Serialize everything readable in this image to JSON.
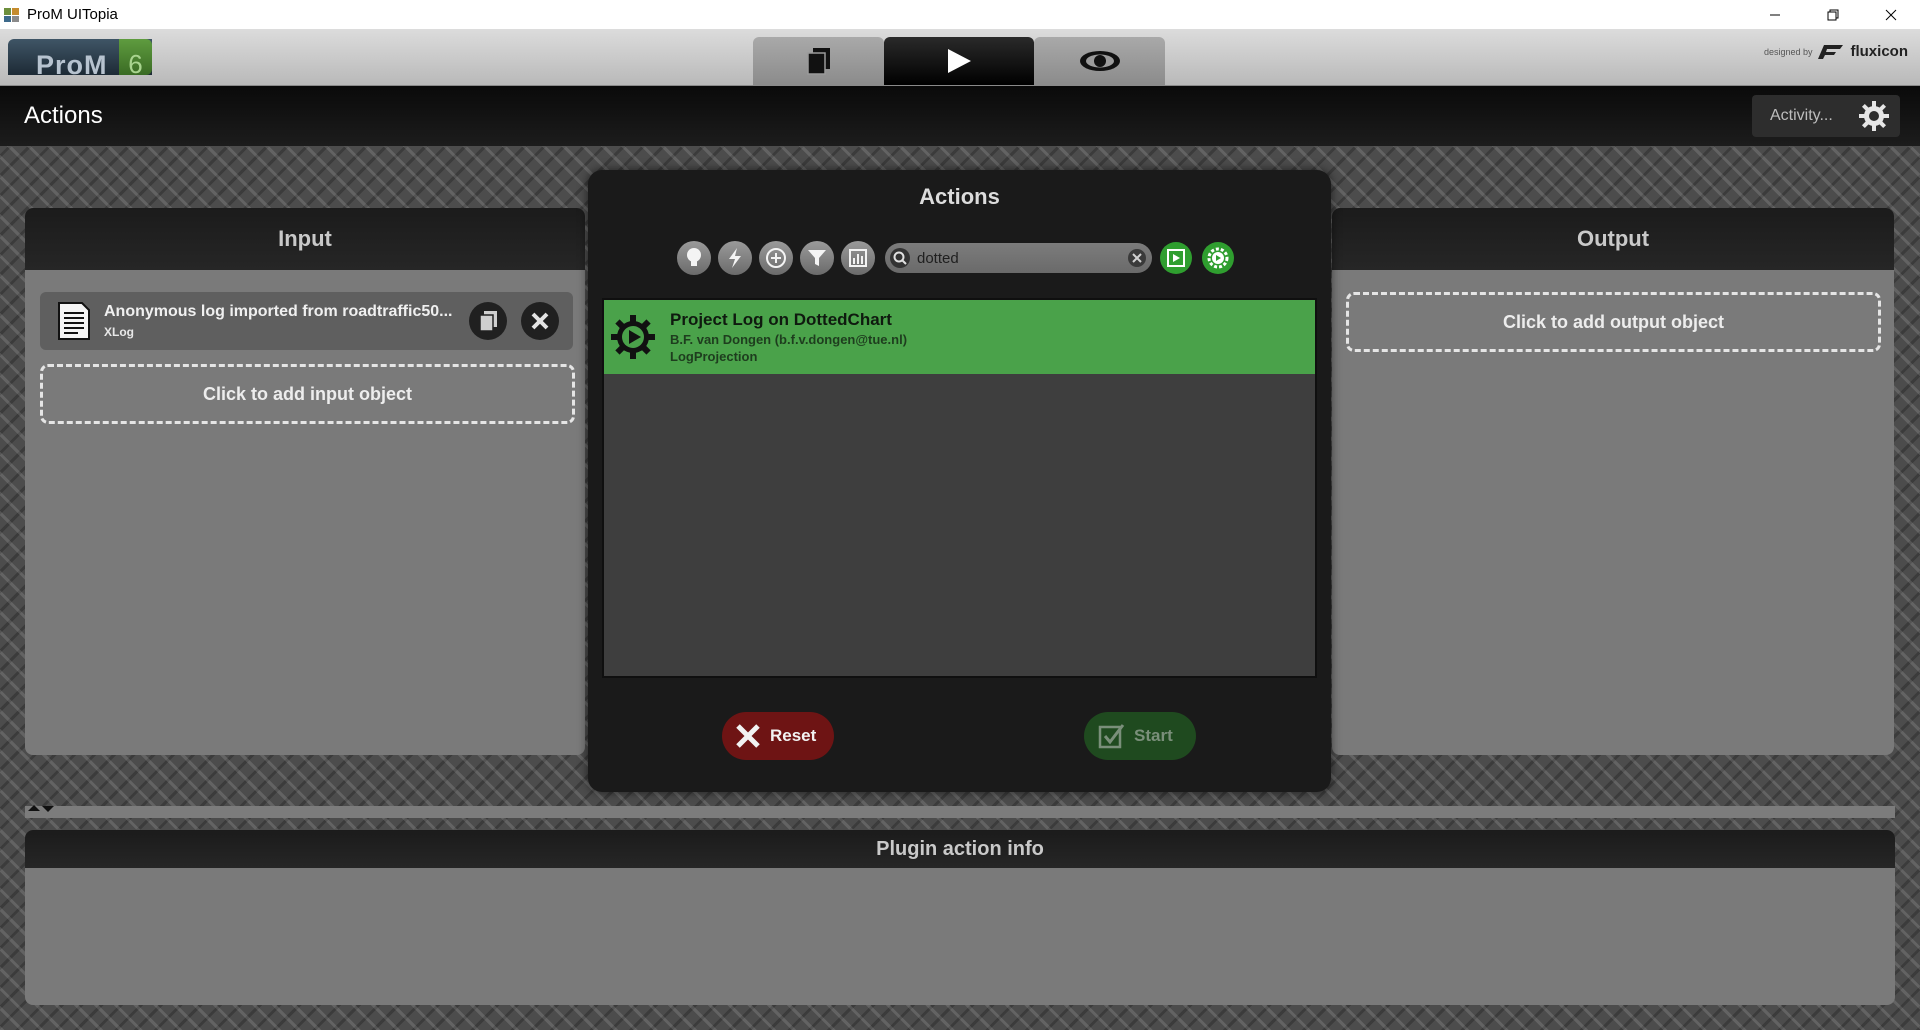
{
  "window": {
    "title": "ProM UITopia"
  },
  "topbar": {
    "logo_text": "ProM",
    "logo_version": "6",
    "tabs": [
      {
        "name": "workspace",
        "icon": "documents-icon"
      },
      {
        "name": "actions",
        "icon": "play-icon",
        "active": true
      },
      {
        "name": "views",
        "icon": "eye-icon"
      }
    ],
    "designed_by": "designed by",
    "brand": "fluxicon"
  },
  "header": {
    "title": "Actions",
    "activity_label": "Activity..."
  },
  "input_panel": {
    "title": "Input",
    "item": {
      "name": "Anonymous log imported from roadtraffic50...",
      "type": "XLog"
    },
    "add_label": "Click to add input object"
  },
  "dialog": {
    "title": "Actions",
    "search": {
      "value": "dotted",
      "placeholder": ""
    },
    "result": {
      "title": "Project Log on DottedChart",
      "author": "B.F. van Dongen (b.f.v.dongen@tue.nl)",
      "type": "LogProjection"
    },
    "reset_label": "Reset",
    "start_label": "Start"
  },
  "output_panel": {
    "title": "Output",
    "add_label": "Click to add output object"
  },
  "info_panel": {
    "title": "Plugin action info"
  },
  "colors": {
    "accent_green": "#4aa24a",
    "reset_red": "#6e1414",
    "start_green": "#1f4a1f"
  }
}
